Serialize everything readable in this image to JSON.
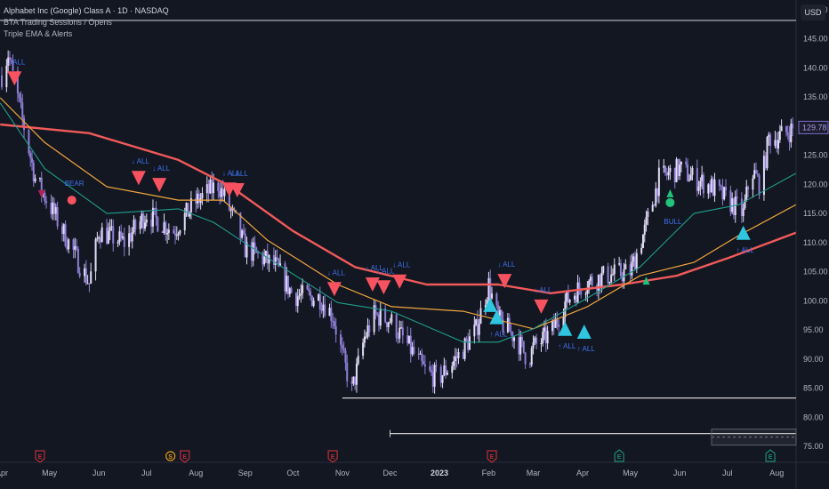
{
  "header": {
    "title": "Alphabet Inc (Google) Class A · 1D · NASDAQ",
    "indicators": [
      "BTA Trading Sessions / Opens",
      "Triple EMA & Alerts"
    ],
    "currency": "USD"
  },
  "colors": {
    "background": "#131722",
    "candle_up": "#e3dcf7",
    "candle_down": "#8f7fd6",
    "ema_slow": "#f05a5a",
    "ema_mid": "#f0a63c",
    "ema_fast": "#1f9f8c",
    "sell_signal": "#f7525f",
    "buy_signal": "#2fc6e0",
    "bull_signal": "#22c27a",
    "alert_text": "#3d72ee",
    "earnings_red": "#b8303a",
    "earnings_green": "#1f8a70",
    "dividend": "#e09a1a"
  },
  "chart_data": {
    "type": "candlestick",
    "title": "",
    "xlabel": "",
    "ylabel": "",
    "xlim": [
      "2022-04-01",
      "2023-08-15"
    ],
    "ylim": [
      73,
      151.5
    ],
    "grid": false,
    "last_price": "129.78",
    "y_ticks": [
      "150.00",
      "145.00",
      "140.00",
      "135.00",
      "130.00",
      "125.00",
      "120.00",
      "115.00",
      "110.00",
      "105.00",
      "100.00",
      "95.00",
      "90.00",
      "85.00",
      "80.00",
      "75.00"
    ],
    "x_ticks": [
      {
        "label": "Apr",
        "date": "2022-04-01"
      },
      {
        "label": "May",
        "date": "2022-05-01"
      },
      {
        "label": "Jun",
        "date": "2022-06-01"
      },
      {
        "label": "Jul",
        "date": "2022-07-01"
      },
      {
        "label": "Aug",
        "date": "2022-08-01"
      },
      {
        "label": "Sep",
        "date": "2022-09-01"
      },
      {
        "label": "Oct",
        "date": "2022-10-01"
      },
      {
        "label": "Nov",
        "date": "2022-11-01"
      },
      {
        "label": "Dec",
        "date": "2022-12-01"
      },
      {
        "label": "2023",
        "date": "2023-01-01",
        "bold": true
      },
      {
        "label": "Feb",
        "date": "2023-02-01"
      },
      {
        "label": "Mar",
        "date": "2023-03-01"
      },
      {
        "label": "Apr",
        "date": "2023-04-01"
      },
      {
        "label": "May",
        "date": "2023-05-01"
      },
      {
        "label": "Jun",
        "date": "2023-06-01"
      },
      {
        "label": "Jul",
        "date": "2023-07-01"
      },
      {
        "label": "Aug",
        "date": "2023-08-01"
      }
    ],
    "price_path": [
      [
        "2022-04-01",
        138.7
      ],
      [
        "2022-04-05",
        142.5
      ],
      [
        "2022-04-22",
        121
      ],
      [
        "2022-05-01",
        116.5
      ],
      [
        "2022-05-26",
        103
      ],
      [
        "2022-06-01",
        112
      ],
      [
        "2022-06-17",
        110
      ],
      [
        "2022-07-01",
        115
      ],
      [
        "2022-07-18",
        112
      ],
      [
        "2022-08-01",
        117
      ],
      [
        "2022-08-15",
        120
      ],
      [
        "2022-08-26",
        113.5
      ],
      [
        "2022-09-01",
        109
      ],
      [
        "2022-09-20",
        106
      ],
      [
        "2022-10-01",
        101
      ],
      [
        "2022-10-18",
        100.5
      ],
      [
        "2022-10-26",
        97.5
      ],
      [
        "2022-11-01",
        90.6
      ],
      [
        "2022-11-07",
        84.5
      ],
      [
        "2022-11-15",
        93.7
      ],
      [
        "2022-11-21",
        97.5
      ],
      [
        "2022-12-01",
        96.7
      ],
      [
        "2022-12-13",
        92
      ],
      [
        "2022-12-24",
        87.5
      ],
      [
        "2023-01-01",
        86.8
      ],
      [
        "2023-01-13",
        90.6
      ],
      [
        "2023-01-24",
        95
      ],
      [
        "2023-02-01",
        102.8
      ],
      [
        "2023-02-07",
        96.7
      ],
      [
        "2023-02-18",
        93.7
      ],
      [
        "2023-02-26",
        89.8
      ],
      [
        "2023-03-01",
        92
      ],
      [
        "2023-03-12",
        94.4
      ],
      [
        "2023-03-21",
        99.7
      ],
      [
        "2023-04-01",
        102.8
      ],
      [
        "2023-04-15",
        104.3
      ],
      [
        "2023-05-01",
        105
      ],
      [
        "2023-05-10",
        112
      ],
      [
        "2023-05-19",
        121
      ],
      [
        "2023-06-01",
        122.7
      ],
      [
        "2023-06-10",
        121
      ],
      [
        "2023-06-21",
        119.6
      ],
      [
        "2023-07-01",
        117.3
      ],
      [
        "2023-07-11",
        115
      ],
      [
        "2023-07-16",
        122.7
      ],
      [
        "2023-07-22",
        119.6
      ],
      [
        "2023-07-27",
        128
      ],
      [
        "2023-08-01",
        128
      ],
      [
        "2023-08-13",
        129.78
      ]
    ],
    "series": [
      {
        "key": "ema_slow",
        "values": [
          [
            "2022-03-31",
            130.3
          ],
          [
            "2022-05-26",
            128.8
          ],
          [
            "2022-07-21",
            124.2
          ],
          [
            "2022-08-23",
            119.6
          ],
          [
            "2022-10-01",
            112
          ],
          [
            "2022-11-09",
            105.8
          ],
          [
            "2022-12-24",
            102.8
          ],
          [
            "2023-02-07",
            102.8
          ],
          [
            "2023-03-12",
            101.3
          ],
          [
            "2023-04-26",
            102.8
          ],
          [
            "2023-05-30",
            104.3
          ],
          [
            "2023-07-02",
            107.4
          ],
          [
            "2023-08-13",
            111.7
          ]
        ]
      },
      {
        "key": "ema_mid",
        "values": [
          [
            "2022-03-31",
            134.9
          ],
          [
            "2022-04-28",
            127.2
          ],
          [
            "2022-06-06",
            119.6
          ],
          [
            "2022-07-21",
            117.3
          ],
          [
            "2022-08-18",
            117.3
          ],
          [
            "2022-09-15",
            110.4
          ],
          [
            "2022-10-29",
            102.8
          ],
          [
            "2022-12-02",
            99
          ],
          [
            "2023-01-16",
            98.2
          ],
          [
            "2023-03-01",
            95.2
          ],
          [
            "2023-04-04",
            99
          ],
          [
            "2023-05-07",
            104.3
          ],
          [
            "2023-06-10",
            106.6
          ],
          [
            "2023-07-08",
            111.2
          ],
          [
            "2023-08-13",
            116.5
          ]
        ]
      },
      {
        "key": "ema_fast",
        "values": [
          [
            "2022-03-31",
            134
          ],
          [
            "2022-04-28",
            122.7
          ],
          [
            "2022-06-06",
            115
          ],
          [
            "2022-07-21",
            115.8
          ],
          [
            "2022-08-12",
            113.5
          ],
          [
            "2022-09-15",
            107.4
          ],
          [
            "2022-10-29",
            99.7
          ],
          [
            "2022-12-02",
            98.2
          ],
          [
            "2023-01-16",
            92.9
          ],
          [
            "2023-02-07",
            92.9
          ],
          [
            "2023-03-01",
            95.2
          ],
          [
            "2023-04-04",
            100.5
          ],
          [
            "2023-05-07",
            105.8
          ],
          [
            "2023-06-10",
            115
          ],
          [
            "2023-07-08",
            116.5
          ],
          [
            "2023-08-13",
            121.9
          ]
        ]
      }
    ],
    "signals": [
      {
        "type": "sell",
        "date": "2022-04-09",
        "price": 138.2,
        "label": "↓ ALL"
      },
      {
        "type": "sell",
        "date": "2022-06-26",
        "price": 121.1,
        "label": "↓ ALL"
      },
      {
        "type": "sell",
        "date": "2022-07-09",
        "price": 119.9,
        "label": "↓ ALL"
      },
      {
        "type": "sell",
        "date": "2022-08-22",
        "price": 119.1,
        "label": "↓ ALL"
      },
      {
        "type": "sell",
        "date": "2022-08-27",
        "price": 119.0,
        "label": "↓ ALL"
      },
      {
        "type": "sell",
        "date": "2022-10-27",
        "price": 102.0,
        "label": "↓ ALL"
      },
      {
        "type": "sell",
        "date": "2022-11-20",
        "price": 102.8,
        "label": "↓ ALL"
      },
      {
        "type": "sell",
        "date": "2022-11-27",
        "price": 102.3,
        "label": "↓ ALL"
      },
      {
        "type": "sell",
        "date": "2022-12-07",
        "price": 103.3,
        "label": "↓ ALL"
      },
      {
        "type": "sell",
        "date": "2023-02-11",
        "price": 103.4,
        "label": "↓ ALL"
      },
      {
        "type": "sell",
        "date": "2023-03-06",
        "price": 99.0,
        "label": "↓ ALL"
      },
      {
        "type": "buy",
        "date": "2023-02-02",
        "price": 99.3,
        "label": ""
      },
      {
        "type": "buy",
        "date": "2023-02-06",
        "price": 97.2,
        "label": "↑ ALL"
      },
      {
        "type": "buy",
        "date": "2023-03-21",
        "price": 95.2,
        "label": "↑ ALL"
      },
      {
        "type": "buy",
        "date": "2023-04-02",
        "price": 94.7,
        "label": "↑ ALL"
      },
      {
        "type": "buy",
        "date": "2023-07-11",
        "price": 111.7,
        "label": "↑ ALL"
      },
      {
        "type": "bull",
        "date": "2023-05-11",
        "price": 103.4,
        "label": ""
      },
      {
        "type": "bull",
        "date": "2023-05-26",
        "price": 118.4,
        "label": "BULL"
      },
      {
        "type": "bear",
        "date": "2022-05-15",
        "price": 117.3,
        "label": "BEAR"
      },
      {
        "type": "bear-small",
        "date": "2022-04-26",
        "price": 118.4,
        "label": ""
      }
    ],
    "horizontal_lines": [
      {
        "price": 83.3,
        "from": "2022-11-01"
      },
      {
        "price": 77.2,
        "from": "2022-12-01"
      }
    ],
    "events": [
      {
        "type": "E",
        "date": "2022-04-25",
        "color": "earnings_red"
      },
      {
        "type": "S",
        "date": "2022-07-16",
        "color": "dividend"
      },
      {
        "type": "E",
        "date": "2022-07-25",
        "color": "earnings_red"
      },
      {
        "type": "E",
        "date": "2022-10-26",
        "color": "earnings_red"
      },
      {
        "type": "E",
        "date": "2023-02-03",
        "color": "earnings_red"
      },
      {
        "type": "E",
        "date": "2023-04-24",
        "color": "earnings_green"
      },
      {
        "type": "E",
        "date": "2023-07-28",
        "color": "earnings_green"
      }
    ]
  }
}
